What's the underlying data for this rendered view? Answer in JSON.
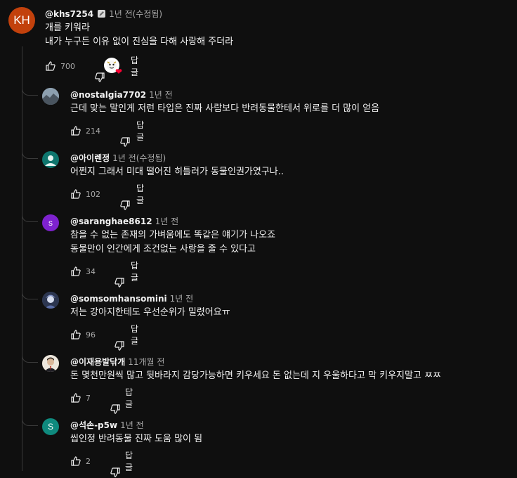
{
  "comments": {
    "top": {
      "handle": "@khs7254",
      "time": "1년 전(수정됨)",
      "lines": [
        "개를 키워라",
        "내가 누구든 이유 없이 진심을 다해 사랑해 주더라"
      ],
      "likes": "700",
      "reply_label": "답글"
    },
    "replies": [
      {
        "handle": "@nostalgia7702",
        "time": "1년 전",
        "lines": [
          "근데 맞는 말인게 저런 타입은 진짜 사람보다  반려동물한테서 위로를 더 많이 얻음"
        ],
        "likes": "214",
        "reply_label": "답글",
        "avatar_color": "#7a8a9a"
      },
      {
        "handle": "@아이렌정",
        "time": "1년 전(수정됨)",
        "lines": [
          "어쩐지 그래서 미대 떨어진 히틀러가 동물인권가였구나.."
        ],
        "likes": "102",
        "reply_label": "답글",
        "avatar_color": "#0f766e"
      },
      {
        "handle": "@saranghae8612",
        "time": "1년 전",
        "lines": [
          "참을 수 없는 존재의 가벼움에도 똑같은 얘기가 나오죠",
          "동물만이 인간에게 조건없는 사랑을 줄 수 있다고"
        ],
        "likes": "34",
        "reply_label": "답글",
        "avatar_color": "#7e22ce",
        "avatar_letter": "s"
      },
      {
        "handle": "@somsomhansomini",
        "time": "1년 전",
        "lines": [
          "저는 강아지한테도 우선순위가 밀렸어요ㅠ"
        ],
        "likes": "96",
        "reply_label": "답글",
        "avatar_color": "#3b4a6b"
      },
      {
        "handle": "@이재용발닦개",
        "time": "11개월 전",
        "lines": [
          "돈 몇천만원씩 많고 뒷바라지 감당가능하면 키우세요 돈 없는데 지 우울하다고 막 키우지말고 ㅉㅉ"
        ],
        "likes": "7",
        "reply_label": "답글",
        "avatar_color": "#6b5a4a"
      },
      {
        "handle": "@석손-p5w",
        "time": "1년 전",
        "lines": [
          "씹인정 반려동물 진짜 도움 많이 됨"
        ],
        "likes": "2",
        "reply_label": "답글",
        "avatar_color": "#0f8a7e",
        "avatar_letter": "S"
      }
    ]
  },
  "top_avatar_letters": "KH",
  "icons": {
    "like": "thumbs-up-icon",
    "dislike": "thumbs-down-icon",
    "creator_heart": "creator-heart-icon",
    "edit_badge": "edit-badge-icon"
  },
  "colors": {
    "background": "#0f0f0f",
    "text": "#f1f1f1",
    "muted": "#aaaaaa",
    "heart": "#ff0033",
    "top_avatar": "#c2410c"
  }
}
